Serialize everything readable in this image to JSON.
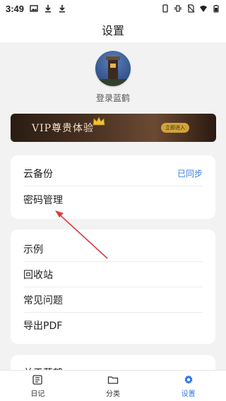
{
  "status_bar": {
    "time": "3:49",
    "left_icons": [
      "image-icon",
      "download-icon",
      "download-icon"
    ],
    "right_icons": [
      "phone-icon",
      "vibrate-icon",
      "no-sim-icon",
      "wifi-icon",
      "battery-icon"
    ]
  },
  "header": {
    "title": "设置"
  },
  "profile": {
    "username": "登录蓝鹤"
  },
  "vip": {
    "title": "VIP尊贵体验",
    "button": "立即进入",
    "accent": "#d1a43a"
  },
  "card1": {
    "rows": [
      {
        "label": "云备份",
        "value": "已同步"
      },
      {
        "label": "密码管理",
        "value": ""
      }
    ]
  },
  "card2": {
    "rows": [
      {
        "label": "示例"
      },
      {
        "label": "回收站"
      },
      {
        "label": "常见问题"
      },
      {
        "label": "导出PDF"
      }
    ]
  },
  "card3": {
    "partial_label": "关于蓝鹤"
  },
  "annotation": {
    "arrow_color": "#e03b3b"
  },
  "tab_bar": {
    "tabs": [
      {
        "label": "日记",
        "icon": "diary-icon"
      },
      {
        "label": "分类",
        "icon": "folder-icon"
      },
      {
        "label": "设置",
        "icon": "gear-icon"
      }
    ],
    "active_color": "#2f76e6"
  }
}
